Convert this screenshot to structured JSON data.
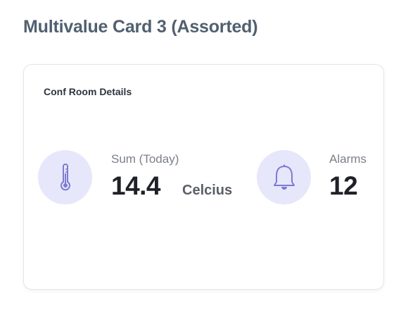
{
  "page": {
    "title": "Multivalue Card 3 (Assorted)"
  },
  "card": {
    "title": "Conf Room Details",
    "metrics": [
      {
        "icon": "thermometer-icon",
        "label": "Sum (Today)",
        "value": "14.4",
        "unit": "Celcius"
      },
      {
        "icon": "bell-icon",
        "label": "Alarms",
        "value": "12"
      }
    ]
  },
  "colors": {
    "icon_bg": "#e7e7fb",
    "icon_stroke": "#7b7bd3",
    "title": "#51606f"
  }
}
